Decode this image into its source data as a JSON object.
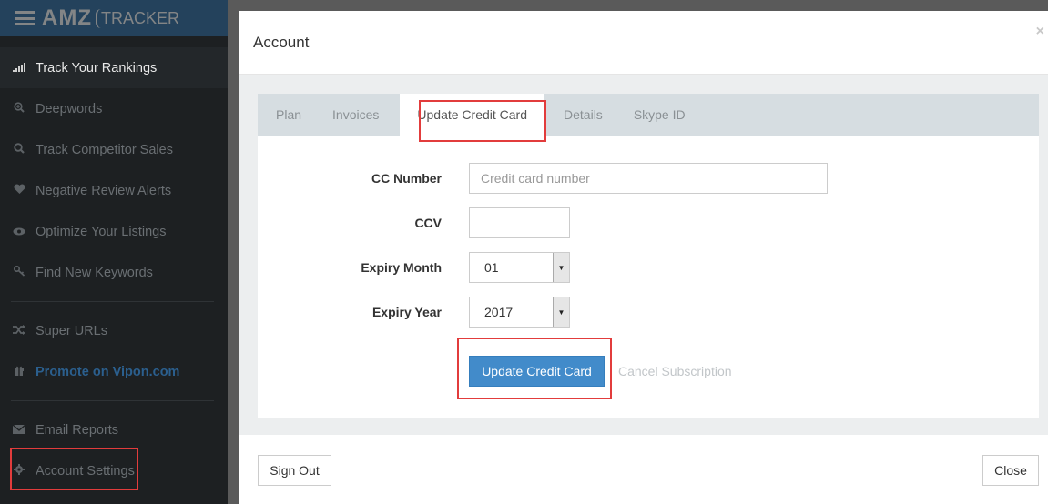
{
  "brand": {
    "logo_main": "AMZ",
    "logo_sub": "TRACKER"
  },
  "sidebar": {
    "items": [
      {
        "label": "Track Your Rankings",
        "icon": "signal-bars-icon"
      },
      {
        "label": "Deepwords",
        "icon": "search-plus-icon"
      },
      {
        "label": "Track Competitor Sales",
        "icon": "search-icon"
      },
      {
        "label": "Negative Review Alerts",
        "icon": "heart-icon"
      },
      {
        "label": "Optimize Your Listings",
        "icon": "eye-icon"
      },
      {
        "label": "Find New Keywords",
        "icon": "key-icon"
      },
      {
        "label": "Super URLs",
        "icon": "shuffle-icon"
      },
      {
        "label": "Promote on Vipon.com",
        "icon": "gift-icon"
      },
      {
        "label": "Email Reports",
        "icon": "envelope-icon"
      },
      {
        "label": "Account Settings",
        "icon": "gear-icon"
      }
    ]
  },
  "modal": {
    "title": "Account",
    "close_x": "×",
    "tabs": [
      {
        "label": "Plan"
      },
      {
        "label": "Invoices"
      },
      {
        "label": "Update Credit Card"
      },
      {
        "label": "Details"
      },
      {
        "label": "Skype ID"
      }
    ],
    "form": {
      "cc_number_label": "CC Number",
      "cc_number_placeholder": "Credit card number",
      "ccv_label": "CCV",
      "ccv_value": "",
      "expiry_month_label": "Expiry Month",
      "expiry_month_value": "01",
      "expiry_year_label": "Expiry Year",
      "expiry_year_value": "2017",
      "submit_label": "Update Credit Card",
      "cancel_label": "Cancel Subscription"
    },
    "footer": {
      "sign_out_label": "Sign Out",
      "close_label": "Close"
    }
  },
  "colors": {
    "primary": "#428bca",
    "highlight": "#e23c3c",
    "sidebar_bg": "#1d2022",
    "brand_bg": "#2e6da4"
  }
}
